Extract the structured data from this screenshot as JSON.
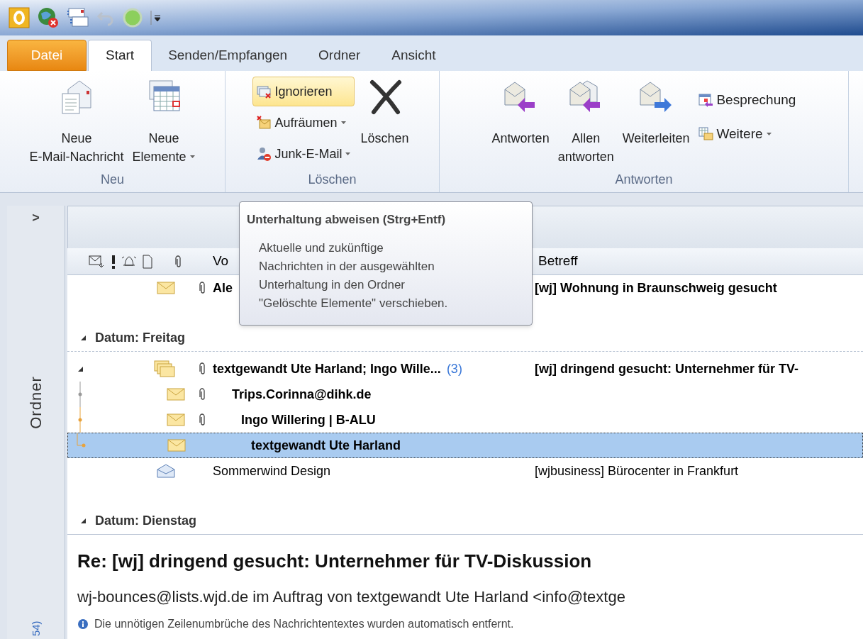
{
  "tabs": [
    {
      "label": "Datei",
      "kind": "file",
      "selected": false
    },
    {
      "label": "Start",
      "kind": "tab",
      "selected": true
    },
    {
      "label": "Senden/Empfangen",
      "kind": "tab",
      "selected": false
    },
    {
      "label": "Ordner",
      "kind": "tab",
      "selected": false
    },
    {
      "label": "Ansicht",
      "kind": "tab",
      "selected": false
    }
  ],
  "ribbon": [
    {
      "label": "Neu",
      "buttons": [
        {
          "kind": "large",
          "lines": [
            "Neue",
            "E-Mail-Nachricht"
          ],
          "dropdown": false,
          "highlighted": false
        },
        {
          "kind": "large",
          "lines": [
            "Neue",
            "Elemente"
          ],
          "dropdown": true,
          "highlighted": false
        }
      ]
    },
    {
      "label": "Löschen",
      "buttons": [
        {
          "kind": "small",
          "lines": [
            "Ignorieren"
          ],
          "dropdown": false,
          "highlighted": true
        },
        {
          "kind": "small",
          "lines": [
            "Aufräumen"
          ],
          "dropdown": true,
          "highlighted": false
        },
        {
          "kind": "small",
          "lines": [
            "Junk-E-Mail"
          ],
          "dropdown": true,
          "highlighted": false
        },
        {
          "kind": "large",
          "lines": [
            "Löschen"
          ],
          "dropdown": false,
          "highlighted": false
        }
      ]
    },
    {
      "label": "Antworten",
      "buttons": [
        {
          "kind": "large",
          "lines": [
            "Antworten"
          ],
          "dropdown": false,
          "highlighted": false
        },
        {
          "kind": "large",
          "lines": [
            "Allen",
            "antworten"
          ],
          "dropdown": false,
          "highlighted": false
        },
        {
          "kind": "large",
          "lines": [
            "Weiterleiten"
          ],
          "dropdown": false,
          "highlighted": false
        },
        {
          "kind": "small",
          "lines": [
            "Besprechung"
          ],
          "dropdown": false,
          "highlighted": false
        },
        {
          "kind": "small",
          "lines": [
            "Weitere"
          ],
          "dropdown": true,
          "highlighted": false
        }
      ]
    }
  ],
  "folder_pane": {
    "expand": ">",
    "label": "Ordner",
    "count": "54)"
  },
  "message_list": {
    "columns": {
      "from": "Vo",
      "subject": "Betreff"
    },
    "groups": [
      {
        "rows": [
          {
            "kind": "message",
            "sender": "Ale",
            "subject": "[wj] Wohnung in Braunschweig gesucht",
            "attachment": true,
            "unread": true,
            "selected": false
          }
        ]
      },
      {
        "label": "Datum: Freitag",
        "expanded": true,
        "rows": [
          {
            "kind": "conversation",
            "sender": "textgewandt Ute Harland;  Ingo Wille...",
            "count": "(3)",
            "subject": "[wj] dringend gesucht: Unternehmer für TV-",
            "attachment": true,
            "unread": true,
            "selected": false,
            "expanded": true,
            "children": [
              {
                "kind": "message",
                "sender": "Trips.Corinna@dihk.de",
                "attachment": true,
                "unread": true,
                "selected": false
              },
              {
                "kind": "message",
                "sender": "Ingo Willering | B-ALU",
                "attachment": true,
                "unread": true,
                "selected": false
              },
              {
                "kind": "message",
                "sender": "textgewandt Ute Harland",
                "attachment": false,
                "unread": true,
                "selected": true
              }
            ]
          },
          {
            "kind": "opened",
            "sender": "Sommerwind Design",
            "subject": "[wjbusiness] Bürocenter in Frankfurt",
            "attachment": false,
            "unread": false,
            "selected": false
          }
        ]
      },
      {
        "label": "Datum: Dienstag",
        "expanded": true
      }
    ]
  },
  "tooltip": {
    "title": "Unterhaltung abweisen (Strg+Entf)",
    "body": [
      "Aktuelle und zukünftige",
      "Nachrichten in der ausgewählten",
      "Unterhaltung in den Ordner",
      "\"Gelöschte Elemente\" verschieben."
    ]
  },
  "reading_pane": {
    "subject": "Re: [wj] dringend gesucht: Unternehmer für TV-Diskussion",
    "from": "wj-bounces@lists.wjd.de im Auftrag von textgewandt Ute Harland <info@textge",
    "info": "Die unnötigen Zeilenumbrüche des Nachrichtentextes wurden automatisch entfernt."
  }
}
